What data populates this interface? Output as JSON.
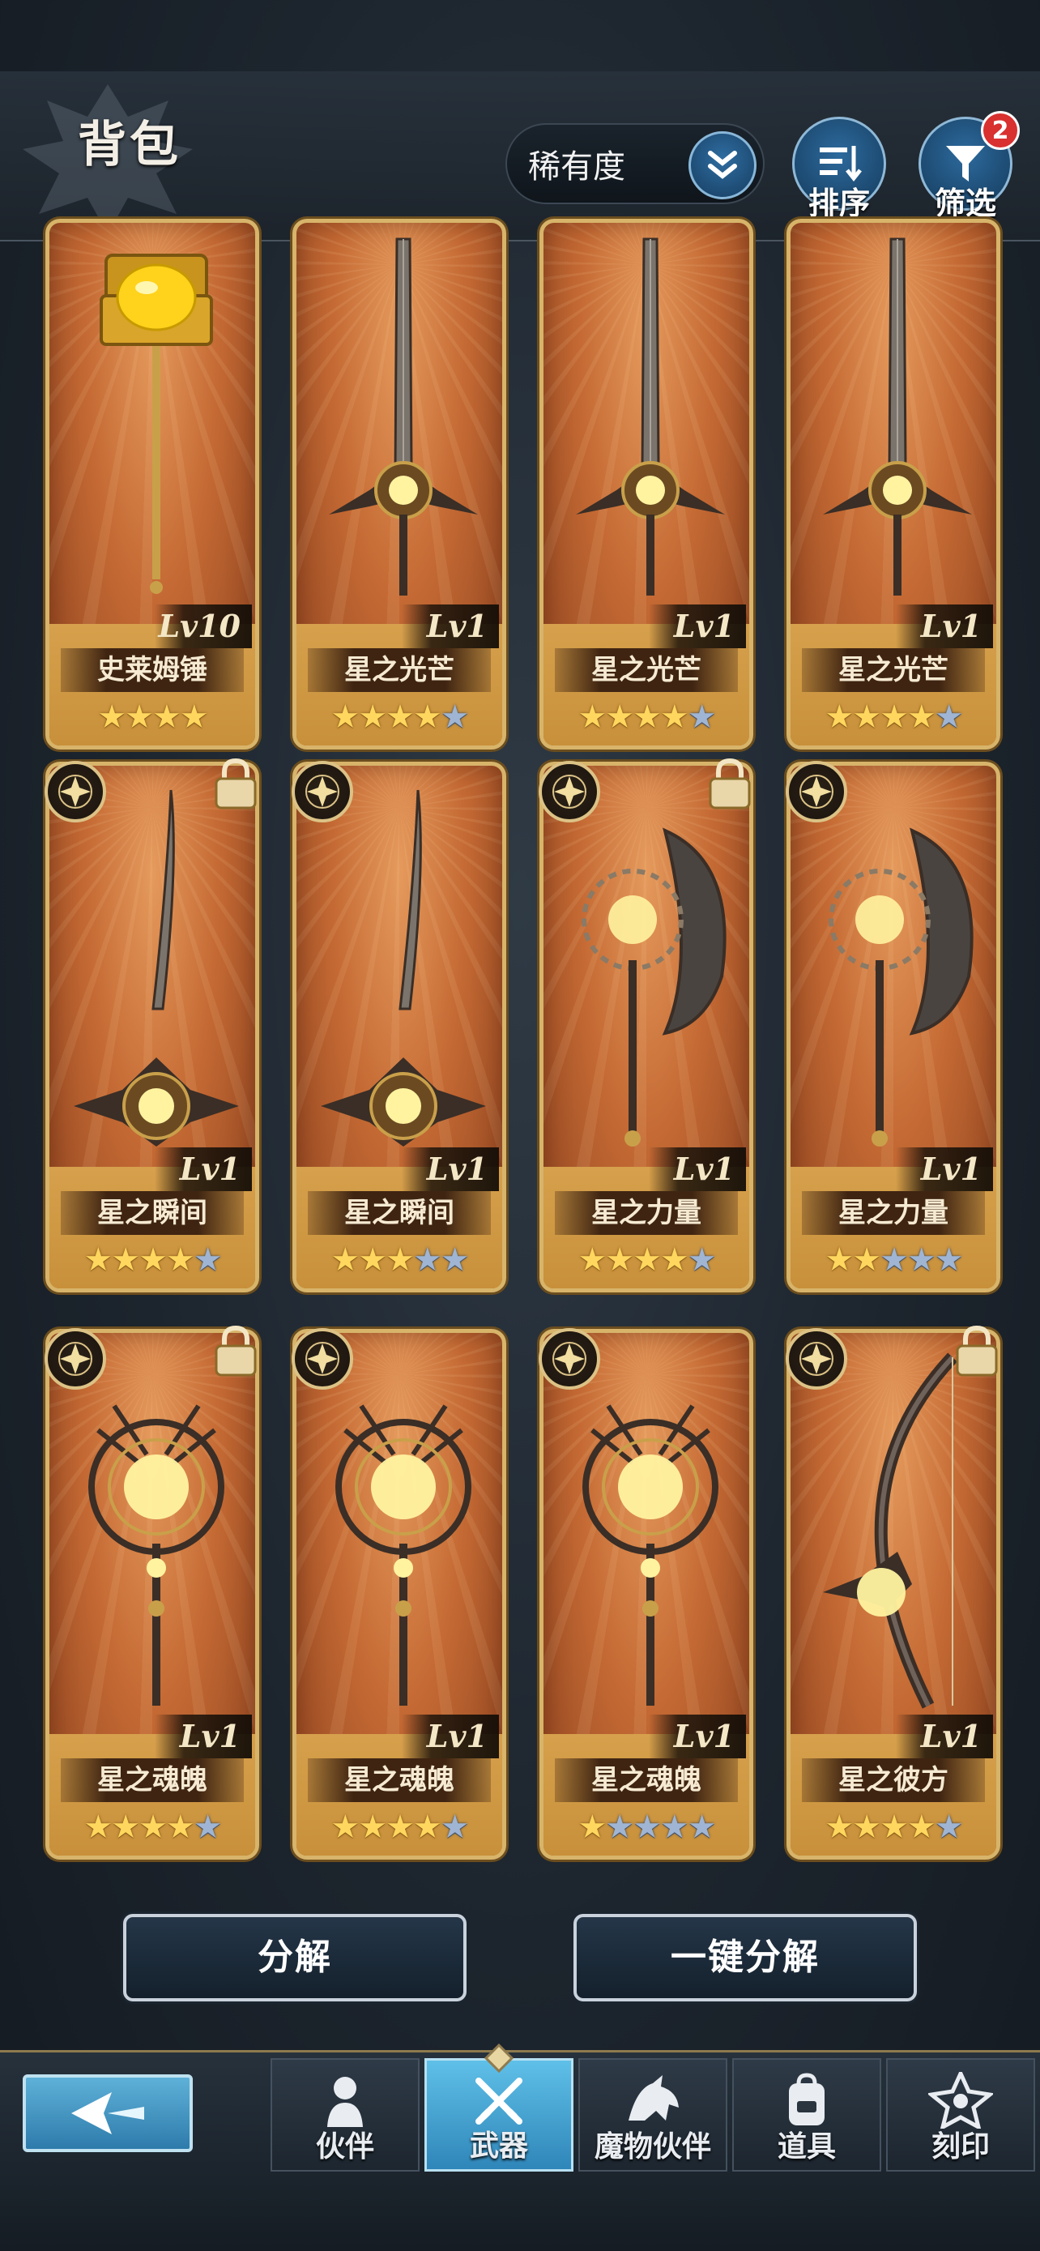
{
  "header": {
    "title": "背包",
    "sort_select": {
      "value": "稀有度"
    },
    "sort_button": {
      "label": "排序"
    },
    "filter_button": {
      "label": "筛选",
      "badge": "2"
    }
  },
  "items": [
    {
      "name": "史莱姆锤",
      "level": "Lv10",
      "stars_gold": 4,
      "stars_silver": 0,
      "emblem": false,
      "locked": false,
      "art": "hammer"
    },
    {
      "name": "星之光芒",
      "level": "Lv1",
      "stars_gold": 4,
      "stars_silver": 1,
      "emblem": false,
      "locked": false,
      "art": "sword"
    },
    {
      "name": "星之光芒",
      "level": "Lv1",
      "stars_gold": 4,
      "stars_silver": 1,
      "emblem": false,
      "locked": false,
      "art": "sword"
    },
    {
      "name": "星之光芒",
      "level": "Lv1",
      "stars_gold": 4,
      "stars_silver": 1,
      "emblem": false,
      "locked": false,
      "art": "sword"
    },
    {
      "name": "星之瞬间",
      "level": "Lv1",
      "stars_gold": 4,
      "stars_silver": 1,
      "emblem": true,
      "locked": true,
      "art": "katana"
    },
    {
      "name": "星之瞬间",
      "level": "Lv1",
      "stars_gold": 3,
      "stars_silver": 2,
      "emblem": true,
      "locked": false,
      "art": "katana"
    },
    {
      "name": "星之力量",
      "level": "Lv1",
      "stars_gold": 4,
      "stars_silver": 1,
      "emblem": true,
      "locked": true,
      "art": "axe"
    },
    {
      "name": "星之力量",
      "level": "Lv1",
      "stars_gold": 2,
      "stars_silver": 3,
      "emblem": true,
      "locked": false,
      "art": "axe"
    },
    {
      "name": "星之魂魄",
      "level": "Lv1",
      "stars_gold": 4,
      "stars_silver": 1,
      "emblem": true,
      "locked": true,
      "art": "staff"
    },
    {
      "name": "星之魂魄",
      "level": "Lv1",
      "stars_gold": 4,
      "stars_silver": 1,
      "emblem": true,
      "locked": false,
      "art": "staff"
    },
    {
      "name": "星之魂魄",
      "level": "Lv1",
      "stars_gold": 1,
      "stars_silver": 4,
      "emblem": true,
      "locked": false,
      "art": "staff"
    },
    {
      "name": "星之彼方",
      "level": "Lv1",
      "stars_gold": 4,
      "stars_silver": 1,
      "emblem": true,
      "locked": true,
      "art": "bow"
    }
  ],
  "actions": {
    "decompose": "分解",
    "decompose_all": "一键分解"
  },
  "nav": {
    "tabs": [
      {
        "label": "伙伴",
        "icon": "companion-icon",
        "active": false
      },
      {
        "label": "武器",
        "icon": "crossed-swords-icon",
        "active": true
      },
      {
        "label": "魔物伙伴",
        "icon": "monster-icon",
        "active": false
      },
      {
        "label": "道具",
        "icon": "backpack-icon",
        "active": false
      },
      {
        "label": "刻印",
        "icon": "emblem-icon",
        "active": false
      }
    ]
  },
  "colors": {
    "card_border": "#d7b46a",
    "card_bg": "#c56a34",
    "star_gold": "#ffd75e",
    "star_silver": "#9fb5d3",
    "accent_blue": "#2f86b9",
    "badge_red": "#d93030"
  }
}
